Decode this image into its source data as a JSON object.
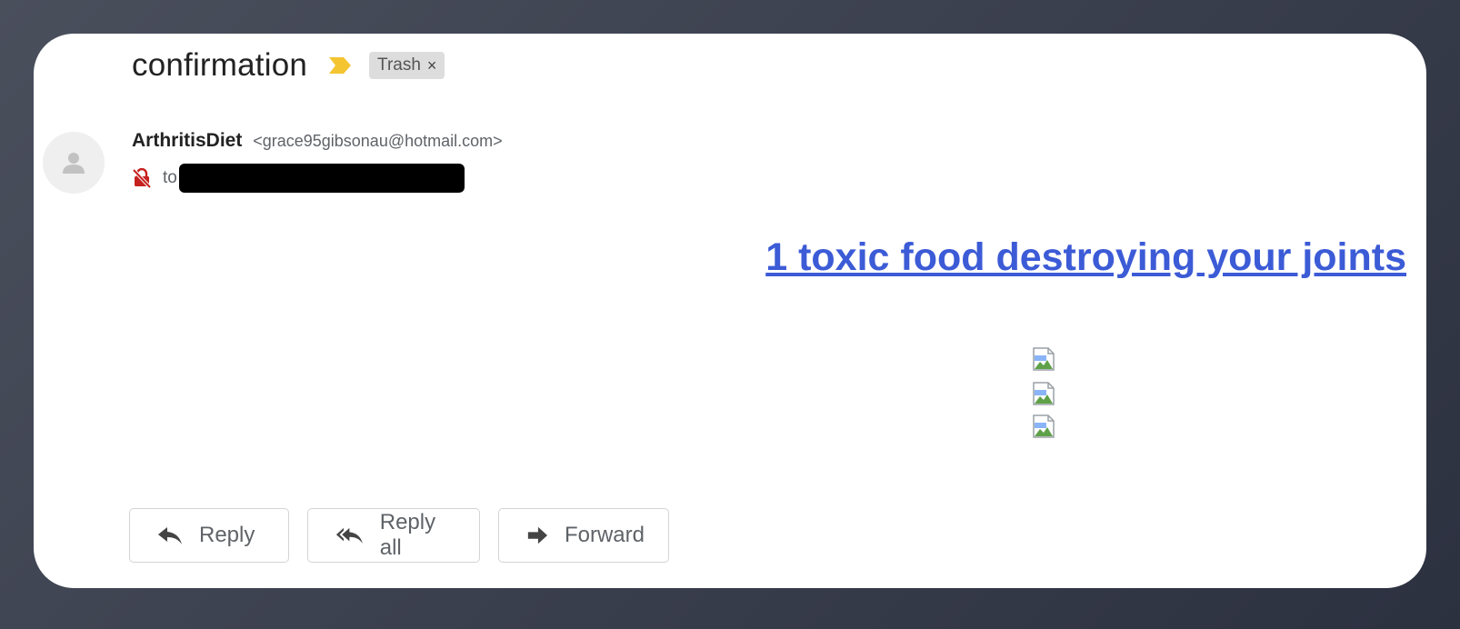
{
  "email": {
    "subject": "confirmation",
    "label": "Trash",
    "label_remove": "×",
    "sender_name": "ArthritisDiet",
    "sender_email": "<grace95gibsonau@hotmail.com>",
    "to_prefix": "to"
  },
  "body": {
    "headline_link": "1 toxic food destroying your joints",
    "broken_image_count": 3
  },
  "actions": {
    "reply": "Reply",
    "reply_all": "Reply all",
    "forward": "Forward"
  },
  "colors": {
    "link": "#3c5bd6",
    "importance": "#f4c531",
    "security_warning": "#c5221f"
  },
  "icons": [
    "importance-marker-icon",
    "close-icon",
    "person-icon",
    "unencrypted-lock-icon",
    "broken-image-icon",
    "reply-icon",
    "reply-all-icon",
    "forward-icon"
  ]
}
